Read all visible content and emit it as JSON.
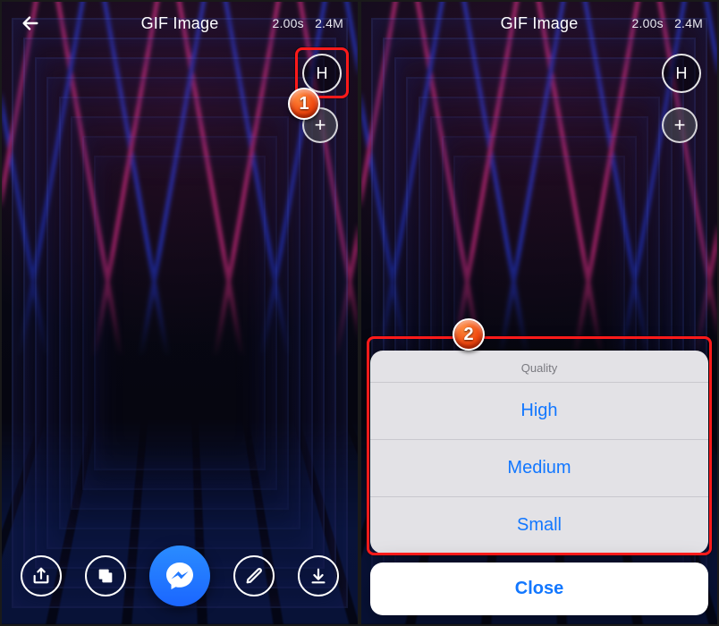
{
  "header": {
    "title": "GIF Image",
    "duration": "2.00s",
    "size": "2.4M"
  },
  "right_buttons": {
    "quality_letter": "H",
    "add_glyph": "+"
  },
  "toolbar": {
    "share": "share",
    "layers": "layers",
    "messenger": "messenger",
    "edit": "edit",
    "download": "download"
  },
  "quality_sheet": {
    "title": "Quality",
    "options": [
      "High",
      "Medium",
      "Small"
    ],
    "close_label": "Close"
  },
  "callouts": {
    "one": "1",
    "two": "2"
  }
}
